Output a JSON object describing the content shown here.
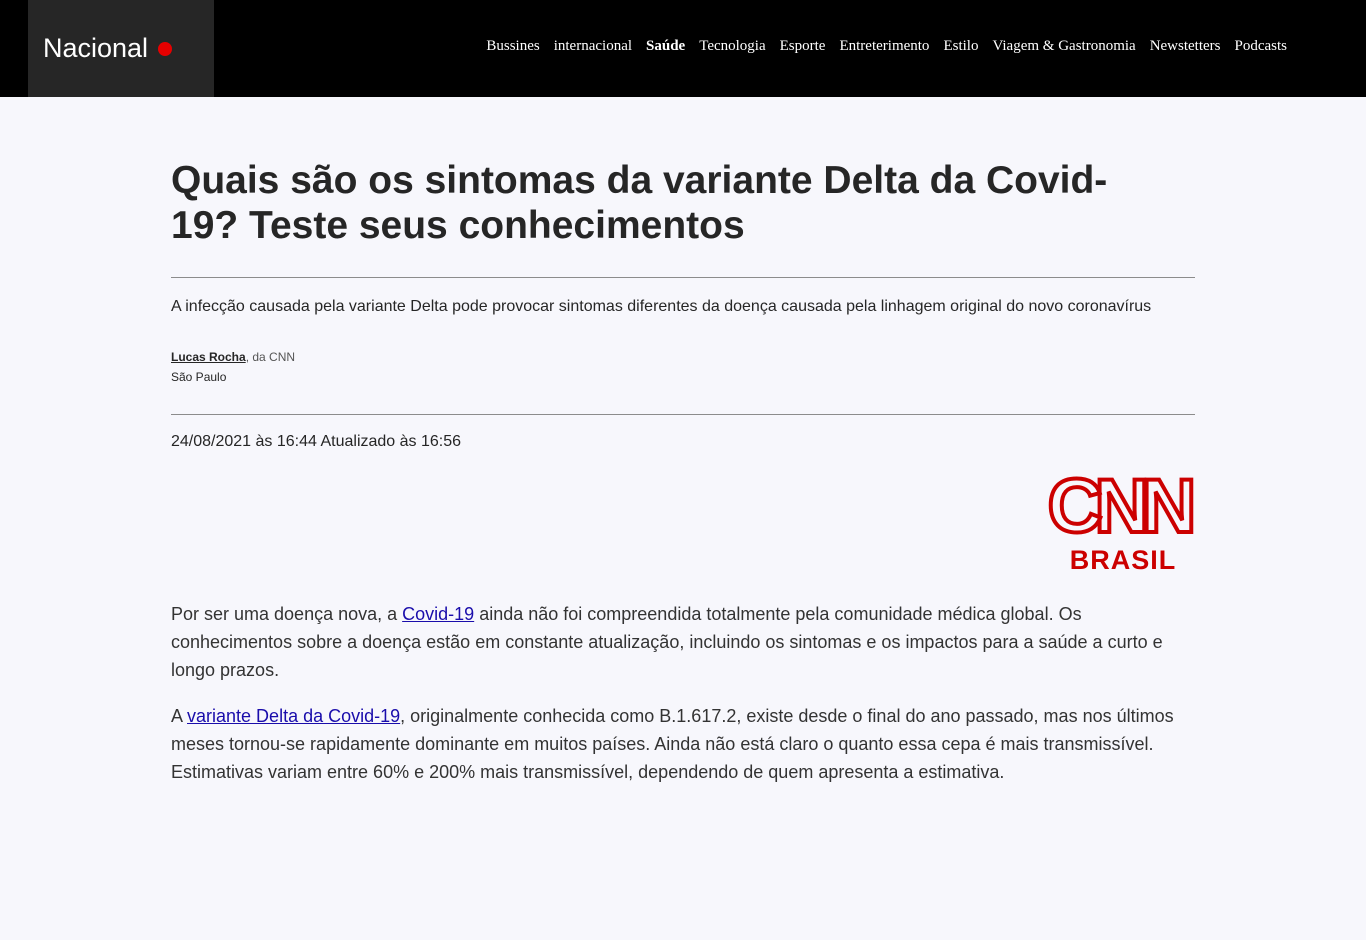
{
  "header": {
    "brand": "Nacional",
    "nav": [
      {
        "label": "Bussines",
        "active": false
      },
      {
        "label": "internacional",
        "active": false
      },
      {
        "label": "Saúde",
        "active": true
      },
      {
        "label": "Tecnologia",
        "active": false
      },
      {
        "label": "Esporte",
        "active": false
      },
      {
        "label": "Entreterimento",
        "active": false
      },
      {
        "label": "Estilo",
        "active": false
      },
      {
        "label": "Viagem & Gastronomia",
        "active": false
      },
      {
        "label": "Newstetters",
        "active": false
      },
      {
        "label": "Podcasts",
        "active": false
      }
    ]
  },
  "article": {
    "headline": "Quais são os sintomas da variante Delta da Covid-19? Teste seus conhecimentos",
    "dek": "A infecção causada pela variante Delta pode provocar sintomas diferentes da doença causada pela linhagem original do novo coronavírus",
    "author": "Lucas Rocha",
    "source": ", da CNN",
    "location": "São Paulo",
    "dateline": "24/08/2021 às 16:44 Atualizado às 16:56",
    "logo": {
      "top": "CNN",
      "bottom": "BRASIL"
    },
    "p1": {
      "before": "Por ser uma doença nova, a ",
      "link": "Covid-19",
      "after": " ainda não foi compreendida totalmente pela comunidade médica global. Os conhecimentos sobre a doença estão em constante atualização, incluindo os sintomas e os impactos para a saúde a curto e longo prazos."
    },
    "p2": {
      "before": "A ",
      "link": "variante Delta da Covid-19",
      "after": ", originalmente conhecida como B.1.617.2, existe desde o final do ano passado, mas nos últimos meses tornou-se rapidamente dominante em muitos países. Ainda não está claro o quanto essa cepa é mais transmissível. Estimativas variam entre 60% e 200% mais transmissível, dependendo de quem apresenta a estimativa."
    }
  },
  "colors": {
    "brand_red": "#cc0000",
    "link": "#1a0dab",
    "topbar": "#000000"
  }
}
